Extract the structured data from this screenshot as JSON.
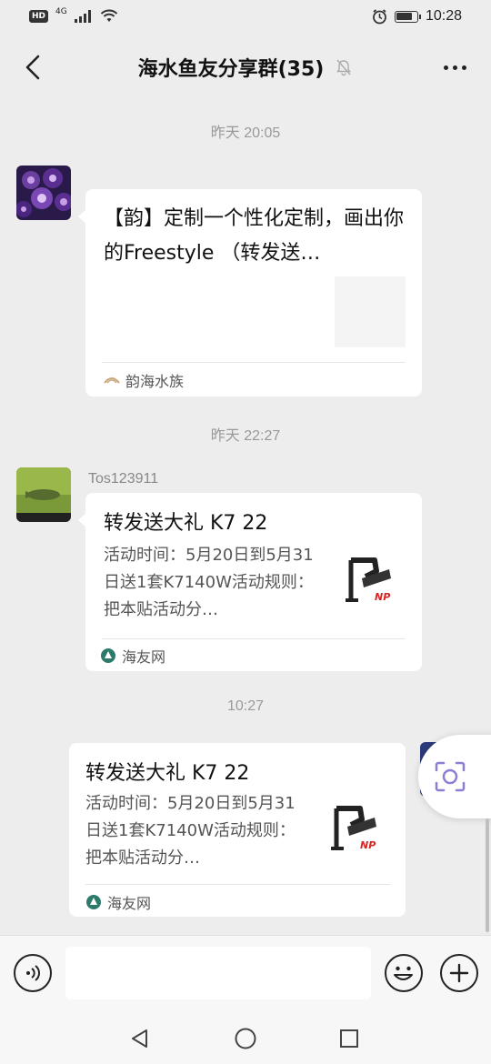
{
  "status_bar": {
    "network_badge": "HD",
    "network_type": "4G",
    "time": "10:28"
  },
  "header": {
    "title": "海水鱼友分享群(35)"
  },
  "messages": [
    {
      "timestamp": "昨天 20:05",
      "title": "【韵】定制一个性化定制，画出你的Freestyle （转发送…",
      "source": "韵海水族"
    },
    {
      "timestamp": "昨天 22:27",
      "sender": "Tos123911",
      "title": "转发送大礼 K7 22",
      "desc": "活动时间：5月20日到5月31日送1套K7140W活动规则：把本贴活动分…",
      "thumb_logo": "NP",
      "source": "海友网"
    },
    {
      "timestamp": "10:27",
      "title": "转发送大礼 K7 22",
      "desc": "活动时间：5月20日到5月31日送1套K7140W活动规则：把本贴活动分…",
      "thumb_logo": "NP",
      "source": "海友网"
    }
  ],
  "input": {
    "value": ""
  },
  "colors": {
    "background": "#ededed",
    "card": "#ffffff",
    "scan_accent": "#8b7fd4"
  }
}
